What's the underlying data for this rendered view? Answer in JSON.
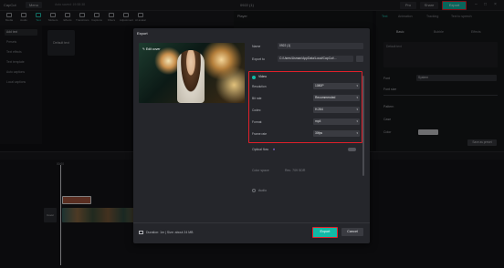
{
  "titlebar": {
    "app_name": "CapCut",
    "menu_label": "Menu",
    "autosave": "Auto saved: 19:58:38",
    "project_title": "0922 (1)",
    "pro_label": "Pro",
    "share_label": "Share",
    "export_label": "Export"
  },
  "toolbar": {
    "items": [
      "Media",
      "Audio",
      "Text",
      "Stickers",
      "Effects",
      "Transitions",
      "Captions",
      "Filters",
      "Adjustment",
      "AI avatar"
    ]
  },
  "sidebar": {
    "items": [
      "Add text",
      "Presets",
      "Text effects",
      "Text template",
      "Auto captions",
      "Local captions"
    ]
  },
  "default_text_label": "Default text",
  "player": {
    "title": "Player"
  },
  "right_panel": {
    "tabs": [
      "Text",
      "Animation",
      "Tracking",
      "Text to speech"
    ],
    "subtabs": [
      "Basic",
      "Bubble",
      "Effects"
    ],
    "default_text": "Default text",
    "font_label": "Font",
    "font_value": "System",
    "font_size_label": "Font size",
    "pattern_label": "Pattern",
    "case_label": "Case",
    "color_label": "Color",
    "save_preset": "Save as preset"
  },
  "dialog": {
    "title": "Export",
    "edit_cover": "Edit cover",
    "name_label": "Name",
    "name_value": "0922 (1)",
    "export_to_label": "Export to",
    "export_to_value": "C:/Users/Usman/AppData/Local/CapCut/...",
    "video_label": "Video",
    "settings": [
      {
        "label": "Resolution",
        "value": "1080P"
      },
      {
        "label": "Bit rate",
        "value": "Recommended"
      },
      {
        "label": "Codec",
        "value": "H.264"
      },
      {
        "label": "Format",
        "value": "mp4"
      },
      {
        "label": "Frame rate",
        "value": "30fps"
      }
    ],
    "optical_flow_label": "Optical flow",
    "color_space_label": "Color space",
    "color_space_value": "Rec. 709 SDR",
    "audio_label": "Audio",
    "footer_info": "Duration: 1m | Size: about 24 MB",
    "export_button": "Export",
    "cancel_button": "Cancel"
  },
  "timeline": {
    "cover_label": "Cover",
    "time_mark": "00:00"
  },
  "colors": {
    "accent": "#12b9a6",
    "highlight": "#e0202a",
    "dialog_bg": "#25262b"
  }
}
